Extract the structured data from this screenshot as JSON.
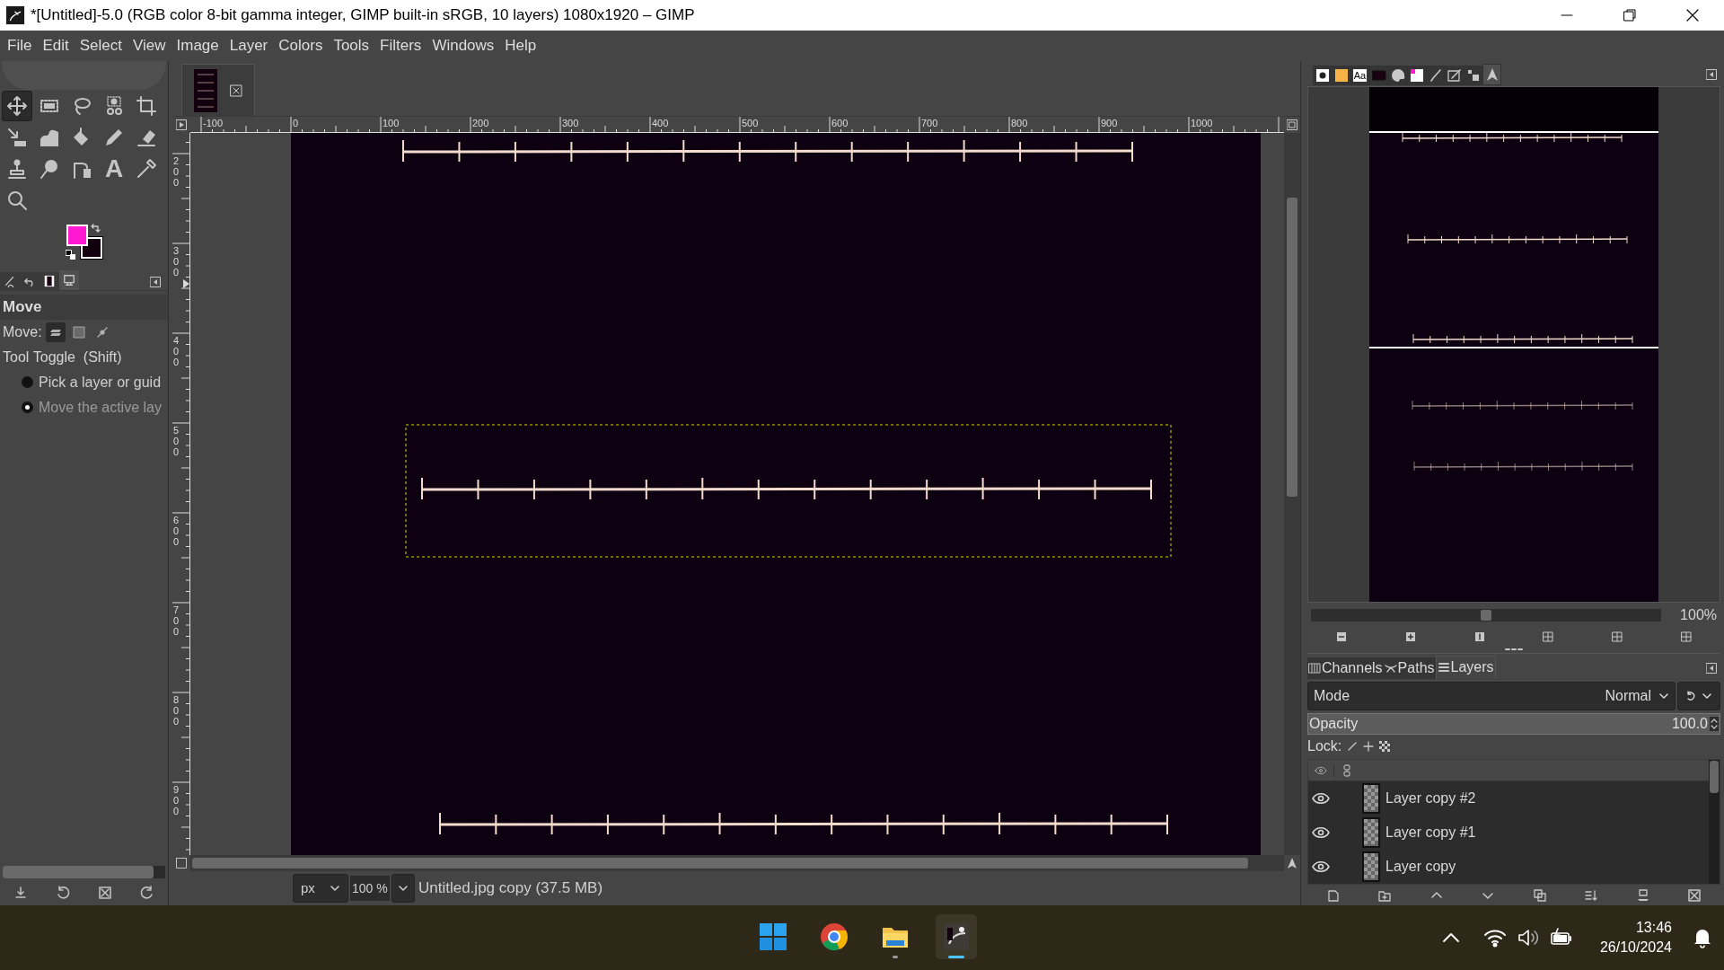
{
  "window": {
    "title": "*[Untitled]-5.0 (RGB color 8-bit gamma integer, GIMP built-in sRGB, 10 layers) 1080x1920 – GIMP"
  },
  "menu": [
    "File",
    "Edit",
    "Select",
    "View",
    "Image",
    "Layer",
    "Colors",
    "Tools",
    "Filters",
    "Windows",
    "Help"
  ],
  "toolbox": {
    "tools": [
      {
        "kind": "move",
        "selected": true
      },
      {
        "kind": "rect-select",
        "selected": false
      },
      {
        "kind": "lasso",
        "selected": false
      },
      {
        "kind": "fuzzy-select",
        "selected": false
      },
      {
        "kind": "crop",
        "selected": false
      },
      {
        "kind": "align",
        "selected": false
      },
      {
        "kind": "warp",
        "selected": false
      },
      {
        "kind": "bucket",
        "selected": false
      },
      {
        "kind": "pencil",
        "selected": false
      },
      {
        "kind": "eraser",
        "selected": false
      },
      {
        "kind": "clone",
        "selected": false
      },
      {
        "kind": "smudge",
        "selected": false
      },
      {
        "kind": "paths",
        "selected": false
      },
      {
        "kind": "text",
        "glyph": "A",
        "selected": false
      },
      {
        "kind": "color-picker",
        "selected": false
      },
      {
        "kind": "zoom",
        "selected": false
      }
    ]
  },
  "dock_tabs": [
    {
      "kind": "device-status",
      "selected": false
    },
    {
      "kind": "undo",
      "selected": false
    },
    {
      "kind": "images",
      "selected": false
    },
    {
      "kind": "display",
      "selected": true
    }
  ],
  "tool_options": {
    "title": "Move",
    "mode_label": "Move:",
    "modes": [
      {
        "kind": "layer",
        "selected": true
      },
      {
        "kind": "selection",
        "selected": false
      },
      {
        "kind": "path",
        "selected": false
      }
    ],
    "toggle_label": "Tool Toggle  (Shift)",
    "choices": [
      {
        "label": "Pick a layer or guid",
        "selected": false
      },
      {
        "label": "Move the active lay",
        "selected": true
      }
    ]
  },
  "rulers": {
    "horizontal": [
      "-100",
      "0",
      "100",
      "200",
      "300",
      "400",
      "500",
      "600",
      "700",
      "800",
      "900",
      "1000"
    ],
    "vertical": [
      "200",
      "300",
      "400",
      "500",
      "600",
      "700",
      "800",
      "900"
    ]
  },
  "status_bar": {
    "unit": "px",
    "zoom": "100 %",
    "info": "Untitled.jpg copy (37.5 MB)"
  },
  "navigation": {
    "tabs": [
      {
        "kind": "brush",
        "selected": false
      },
      {
        "kind": "pattern",
        "selected": false
      },
      {
        "kind": "font",
        "glyph": "Aa",
        "selected": false
      },
      {
        "kind": "image",
        "selected": false
      },
      {
        "kind": "palette",
        "selected": false
      },
      {
        "kind": "colors",
        "selected": false
      },
      {
        "kind": "paintbrush",
        "selected": false
      },
      {
        "kind": "preset",
        "selected": false
      },
      {
        "kind": "dynamics",
        "selected": false
      },
      {
        "kind": "navigation",
        "selected": true
      }
    ],
    "slider": {
      "level": 0.5
    },
    "zoom": "100%"
  },
  "layers_dock": {
    "tabs": [
      {
        "label": "Channels",
        "selected": false
      },
      {
        "label": "Paths",
        "selected": false
      },
      {
        "label": "Layers",
        "selected": true
      }
    ],
    "mode_label": "Mode",
    "mode": "Normal",
    "opacity_label": "Opacity",
    "opacity": "100.0",
    "lock_label": "Lock:",
    "layers": [
      {
        "name": "Layer copy #2",
        "visible": true
      },
      {
        "name": "Layer copy #1",
        "visible": true
      },
      {
        "name": "Layer copy",
        "visible": true
      }
    ]
  },
  "taskbar": {
    "apps": [
      {
        "kind": "start",
        "running": false,
        "selected": false
      },
      {
        "kind": "browser",
        "running": false,
        "selected": false
      },
      {
        "kind": "files",
        "running": true,
        "selected": false
      },
      {
        "kind": "gimp",
        "running": true,
        "selected": true
      }
    ],
    "time": "13:46",
    "date": "26/10/2024"
  }
}
